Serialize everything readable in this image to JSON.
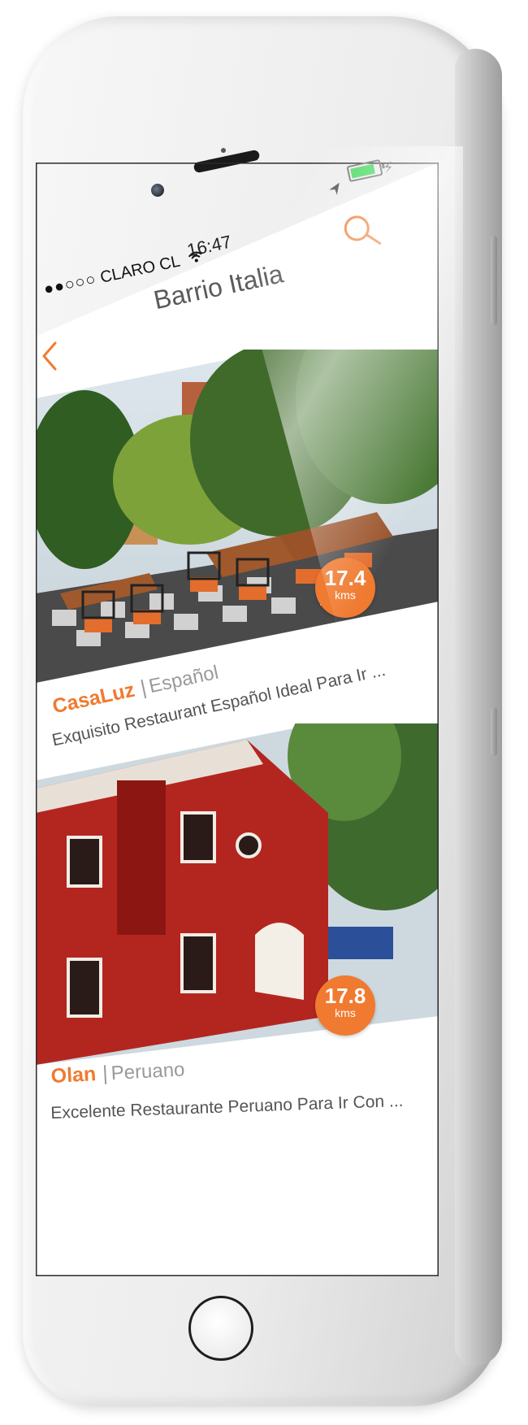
{
  "status_bar": {
    "signal": "●●○○○",
    "carrier": "CLARO CL",
    "time": "16:47",
    "battery_level": 0.85
  },
  "nav": {
    "title": "Barrio Italia"
  },
  "restaurants": [
    {
      "name": "CasaLuz",
      "separator": "|",
      "cuisine": "Español",
      "description": "Exquisito Restaurant Español Ideal Para Ir ...",
      "distance": "17.4",
      "distance_unit": "kms"
    },
    {
      "name": "Olan",
      "separator": "|",
      "cuisine": "Peruano",
      "description": "Excelente Restaurante Peruano Para Ir Con ...",
      "distance": "17.8",
      "distance_unit": "kms"
    }
  ],
  "colors": {
    "accent": "#f07a30",
    "text_muted": "#9a9a9a",
    "text_body": "#555555"
  },
  "icons": {
    "search": "search-icon",
    "back": "back-chevron-icon",
    "wifi": "wifi-icon",
    "location": "location-arrow-icon",
    "battery": "battery-icon"
  }
}
